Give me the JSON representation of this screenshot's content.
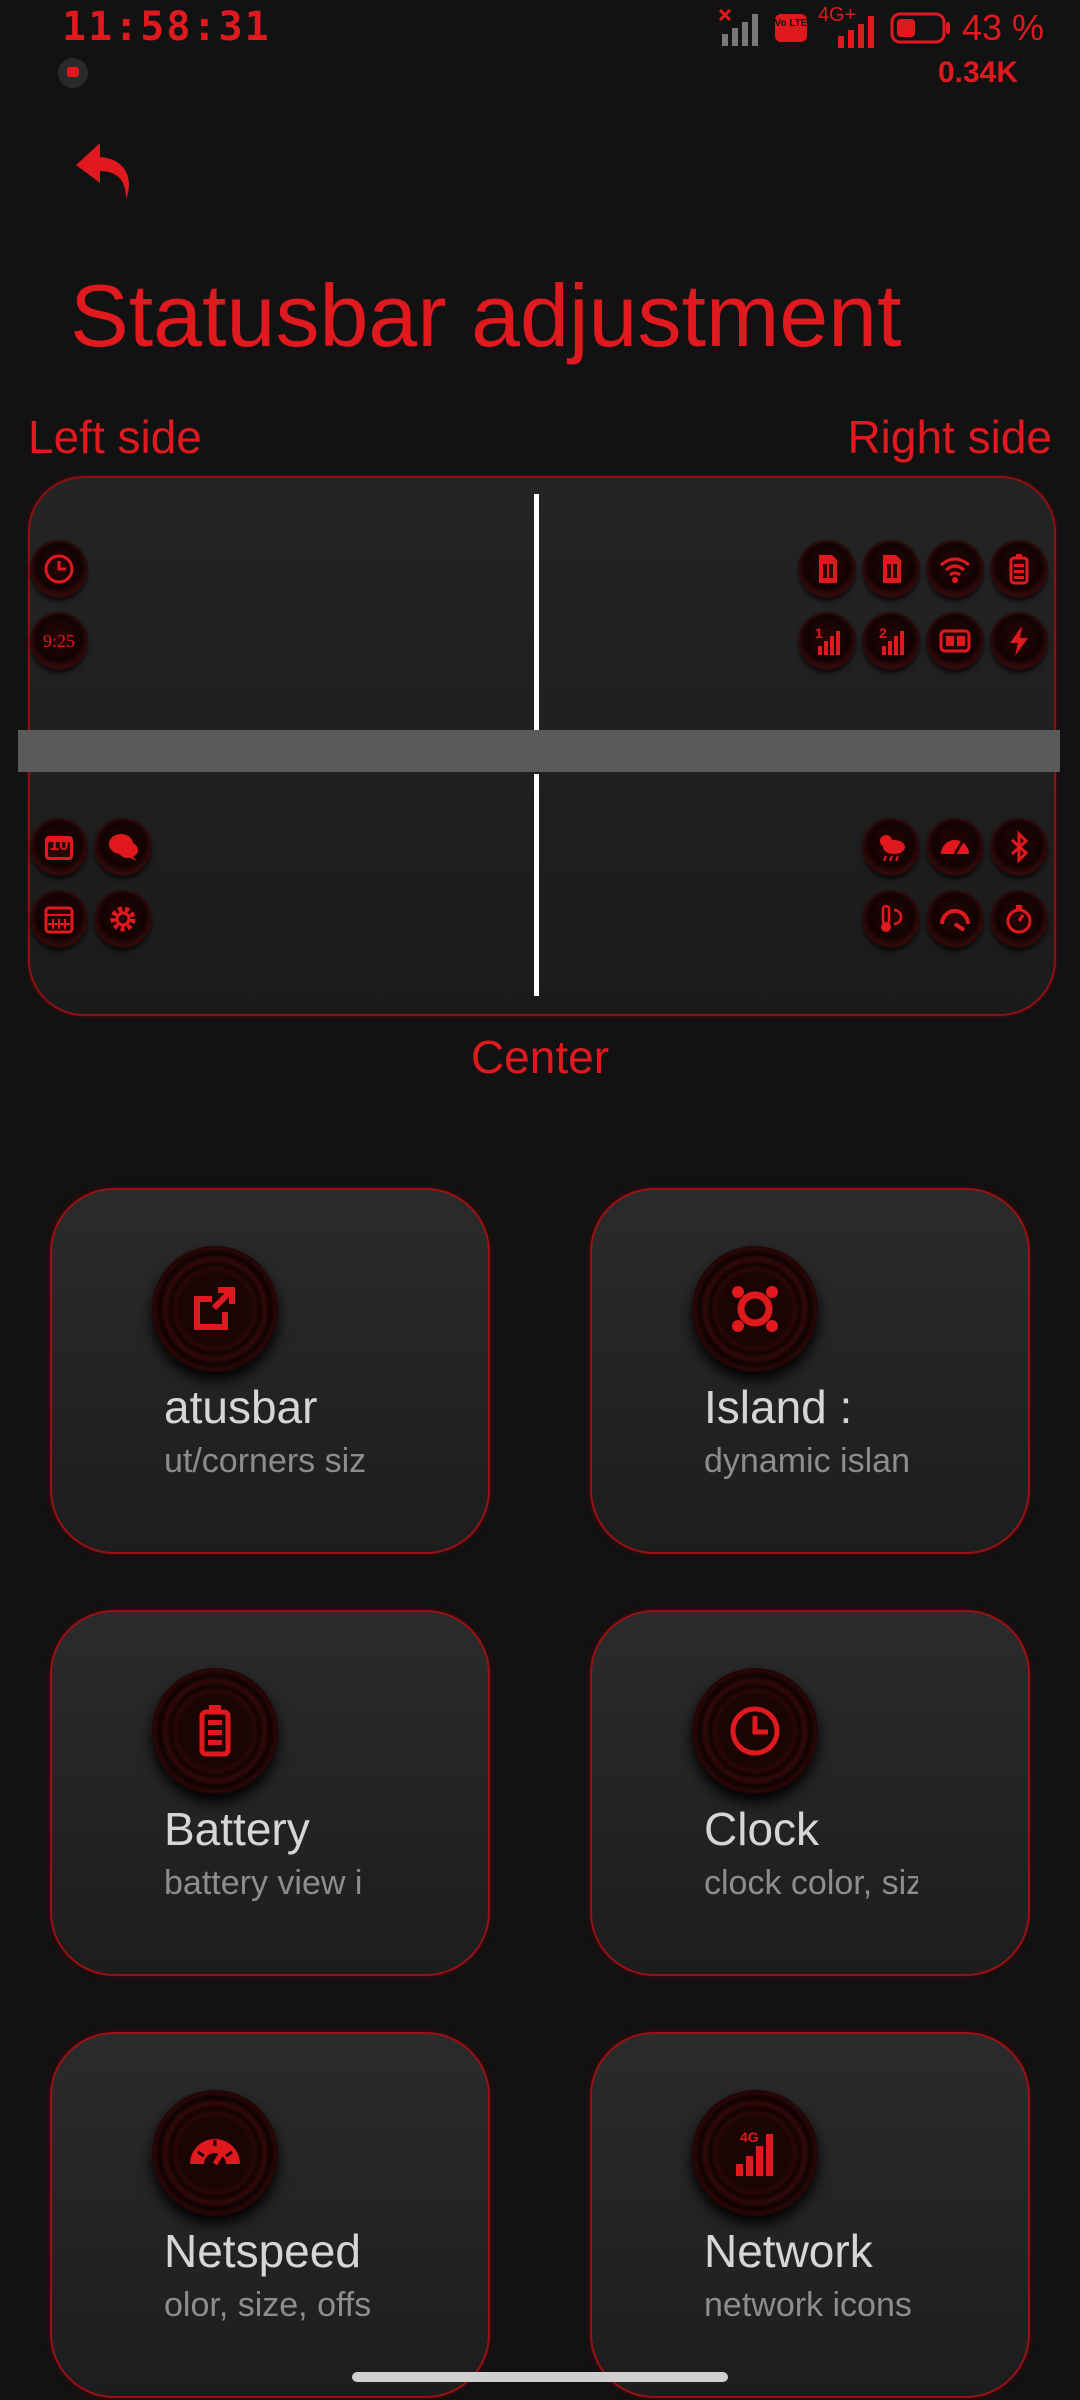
{
  "status_bar": {
    "time": "11:58:31",
    "network_type": "4G+",
    "volte": "Vo LTE",
    "battery_percent": "43 %",
    "net_speed": "0.34K",
    "battery_level": 0.43
  },
  "header": {
    "back_icon": "back-arrow-icon",
    "title": "Statusbar adjustment"
  },
  "preview": {
    "left_label": "Left side",
    "right_label": "Right side",
    "center_label": "Center",
    "top_left_icons": [
      "clock-icon",
      "text-clock-icon"
    ],
    "top_left_clock_text": "9:25",
    "top_right_icons": [
      "sim-card-icon",
      "sim-card-icon",
      "wifi-icon",
      "battery-icon",
      "signal-1-icon",
      "signal-2-icon",
      "wifi-calling-icon",
      "charging-icon"
    ],
    "bottom_left_icons": [
      "calendar-10-icon",
      "chat-icon",
      "calendar-icon",
      "settings-gear-icon"
    ],
    "bottom_left_date_text": "10",
    "bottom_right_icons": [
      "weather-icon",
      "speedometer-icon",
      "bluetooth-icon",
      "temperature-icon",
      "gauge-icon",
      "timer-icon"
    ],
    "accent": "#e0191f"
  },
  "cards": [
    {
      "title": "atusbar",
      "subtitle": "ut/corners siz",
      "icon": "share-box-icon"
    },
    {
      "title": ": Island",
      "subtitle": "dynamic islan",
      "icon": "dynamic-island-icon"
    },
    {
      "title": "Battery",
      "subtitle": "battery view i",
      "icon": "battery-icon"
    },
    {
      "title": "Clock",
      "subtitle": "clock color, siz",
      "icon": "clock-icon"
    },
    {
      "title": "Netspeed",
      "subtitle": "olor, size, offs",
      "icon": "speedometer-icon"
    },
    {
      "title": "Network",
      "subtitle": "network icons",
      "icon": "network-signal-icon",
      "badge": "4G"
    }
  ]
}
